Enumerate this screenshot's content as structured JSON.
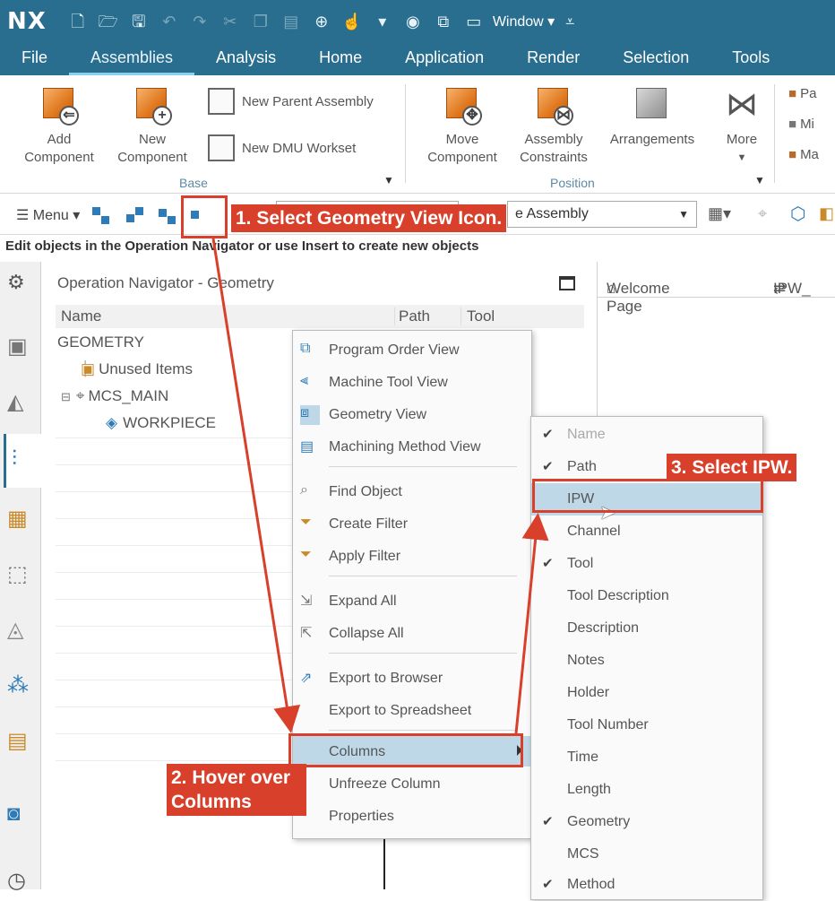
{
  "title_bar": {
    "logo": "NX",
    "window_menu": "Window ▾",
    "quick_access_icons": [
      "new-file-icon",
      "open-file-icon",
      "save-icon",
      "undo-icon",
      "redo-icon",
      "cut-icon",
      "copy-icon",
      "paste-icon",
      "snap-icon",
      "touch-mode-icon",
      "dropdown-icon",
      "view-icon",
      "windows-icon"
    ]
  },
  "menu_bar": {
    "items": [
      "File",
      "Assemblies",
      "Analysis",
      "Home",
      "Application",
      "Render",
      "Selection",
      "Tools"
    ],
    "active": "Assemblies"
  },
  "ribbon": {
    "add_component": "Add\nComponent",
    "new_component": "New\nComponent",
    "new_parent_assembly": "New Parent Assembly",
    "new_dmu_workset": "New DMU Workset",
    "base_group": "Base",
    "move_component": "Move\nComponent",
    "assembly_constraints": "Assembly\nConstraints",
    "arrangements": "Arrangements",
    "more": "More",
    "position_group": "Position",
    "cut_items": [
      "Pa",
      "Mi",
      "Ma"
    ]
  },
  "toolbar": {
    "menu_label": "Menu ▾",
    "assembly_combo": "e Assembly"
  },
  "hint_text": "Edit objects in the Operation Navigator or use Insert to create new objects",
  "navigator": {
    "title": "Operation Navigator - Geometry",
    "columns": [
      "Name",
      "Path",
      "Tool"
    ],
    "tree": [
      "GEOMETRY",
      "Unused Items",
      "MCS_MAIN",
      "WORKPIECE"
    ]
  },
  "right_panel": {
    "tabs": [
      "Welcome Page",
      "IPW_"
    ]
  },
  "context_menu": {
    "items": [
      {
        "label": "Program Order View",
        "icon": "program-order-view-icon"
      },
      {
        "label": "Machine Tool View",
        "icon": "machine-tool-view-icon"
      },
      {
        "label": "Geometry View",
        "icon": "geometry-view-icon",
        "checked": true
      },
      {
        "label": "Machining Method View",
        "icon": "machining-method-view-icon"
      },
      {
        "label": "Find Object",
        "icon": "find-object-icon"
      },
      {
        "label": "Create Filter",
        "icon": "create-filter-icon"
      },
      {
        "label": "Apply Filter",
        "icon": "apply-filter-icon"
      },
      {
        "label": "Expand All",
        "icon": "expand-all-icon"
      },
      {
        "label": "Collapse All",
        "icon": "collapse-all-icon"
      },
      {
        "label": "Export to Browser",
        "icon": "export-browser-icon"
      },
      {
        "label": "Export to Spreadsheet",
        "icon": ""
      },
      {
        "label": "Columns",
        "icon": "",
        "highlighted": true,
        "submenu": true
      },
      {
        "label": "Unfreeze Column",
        "icon": ""
      },
      {
        "label": "Properties",
        "icon": ""
      }
    ]
  },
  "columns_submenu": {
    "items": [
      {
        "label": "Name",
        "checked": true,
        "disabled": true
      },
      {
        "label": "Path",
        "checked": true
      },
      {
        "label": "IPW",
        "checked": false,
        "highlighted": true
      },
      {
        "label": "Channel",
        "checked": false
      },
      {
        "label": "Tool",
        "checked": true
      },
      {
        "label": "Tool Description",
        "checked": false
      },
      {
        "label": "Description",
        "checked": false
      },
      {
        "label": "Notes",
        "checked": false
      },
      {
        "label": "Holder",
        "checked": false
      },
      {
        "label": "Tool Number",
        "checked": false
      },
      {
        "label": "Time",
        "checked": false
      },
      {
        "label": "Length",
        "checked": false
      },
      {
        "label": "Geometry",
        "checked": true
      },
      {
        "label": "MCS",
        "checked": false
      },
      {
        "label": "Method",
        "checked": true
      }
    ]
  },
  "annotations": {
    "step1": "1. Select Geometry View Icon.",
    "step2": "2. Hover over\nColumns",
    "step3": "3. Select IPW.",
    "color": "#d9402b"
  }
}
